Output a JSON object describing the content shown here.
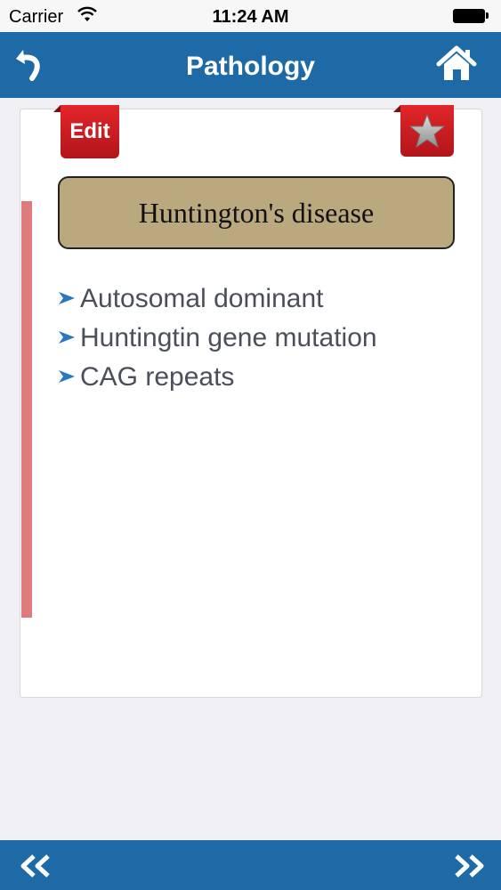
{
  "status_bar": {
    "carrier": "Carrier",
    "time": "11:24 AM",
    "wifi_icon": "wifi-icon",
    "battery_icon": "battery-icon"
  },
  "nav": {
    "title": "Pathology",
    "back_icon": "back-arrow-icon",
    "home_icon": "home-icon"
  },
  "card": {
    "edit_label": "Edit",
    "favorite_icon": "star-icon",
    "title": "Huntington's disease",
    "bullets": [
      "Autosomal dominant",
      "Huntingtin gene mutation",
      "CAG repeats"
    ]
  },
  "bottom_bar": {
    "prev_icon": "double-chevron-left-icon",
    "next_icon": "double-chevron-right-icon"
  },
  "colors": {
    "nav_blue": "#1e6aa6",
    "accent_red": "#d7262b",
    "title_box": "#baa87f",
    "accent_bar": "#df7b7c",
    "bullet_arrow": "#2a78c0"
  }
}
